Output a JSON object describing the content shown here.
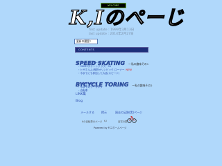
{
  "header": {
    "welcome_label": "WELCOME",
    "logo_text": "K,Iのぺーじ",
    "first_update": "first update : 1999年3月13日",
    "last_update": "last update : 2014年2月27日"
  },
  "message_box": {
    "text": "更新の履歴?"
  },
  "contents": {
    "label": "CONTENTS",
    "speed_skating": {
      "title": "SPEED SKATING",
      "subtitle": "～私の趣味その1",
      "items": [
        "スピードスケートとは",
        "SKIMSスケートクラブ、5A",
        "ヒザホルム(長野オリンピック)コーナー",
        "今までにも参加した大会(スピード)"
      ],
      "new_badge": "NEW"
    },
    "bicycle_touring": {
      "title": "BYCYCLE TORING",
      "subtitle": "～私の趣味その2",
      "items": [
        "自転車の旅と私",
        "今までのツーリング",
        "自転車"
      ]
    },
    "link_label": "LINK集",
    "blog_label": "Blog"
  },
  "footer": {
    "mail_label": "メールする",
    "bbs_label": "掲示",
    "guest_label": "過去の足跡(実)ページ",
    "small_left": "Kの自転車のページ",
    "small_mid": "K,I",
    "small_right": "自宅の壁",
    "powered": "Powered by FC2ホームページ"
  },
  "colors": {
    "background": "#b0d8fb",
    "section_title": "#2c54a8",
    "link": "#2f4fb0",
    "new": "#e01818",
    "contents_bar": "#1d2f7a"
  }
}
